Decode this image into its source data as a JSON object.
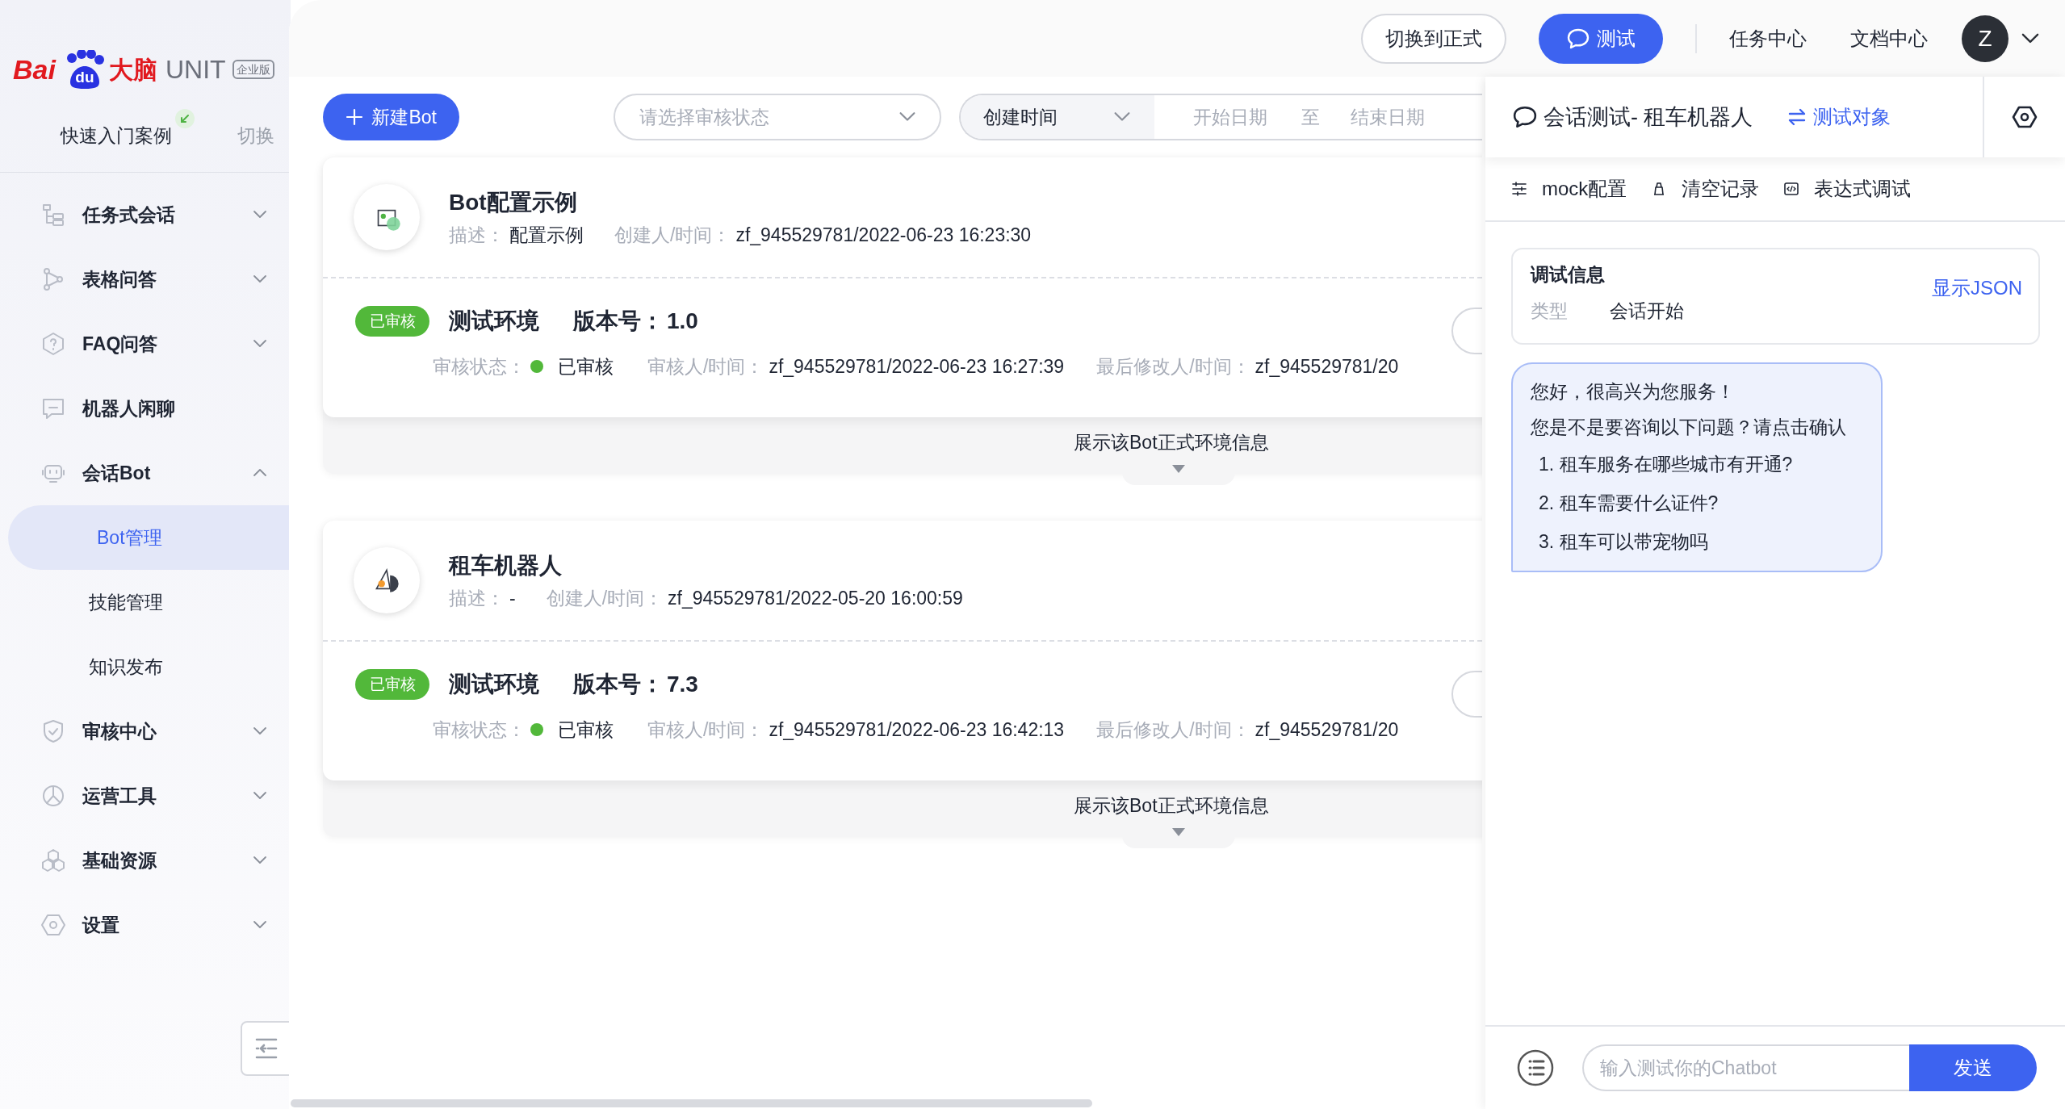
{
  "logo": {
    "brand": "Bai",
    "paw_text": "du",
    "brand_cn": "大脑",
    "product": "UNIT",
    "edition": "企业版"
  },
  "sidebar": {
    "quick_start": "快速入门案例",
    "switch": "切换",
    "items": [
      {
        "label": "任务式会话",
        "kind": "group",
        "expanded": false
      },
      {
        "label": "表格问答",
        "kind": "group",
        "expanded": false
      },
      {
        "label": "FAQ问答",
        "kind": "group",
        "expanded": false
      },
      {
        "label": "机器人闲聊",
        "kind": "link"
      },
      {
        "label": "会话Bot",
        "kind": "group",
        "expanded": true,
        "children": [
          {
            "label": "Bot管理",
            "selected": true
          },
          {
            "label": "技能管理",
            "selected": false
          },
          {
            "label": "知识发布",
            "selected": false
          }
        ]
      },
      {
        "label": "审核中心",
        "kind": "group",
        "expanded": false
      },
      {
        "label": "运营工具",
        "kind": "group",
        "expanded": false
      },
      {
        "label": "基础资源",
        "kind": "group",
        "expanded": false
      },
      {
        "label": "设置",
        "kind": "group",
        "expanded": false
      }
    ]
  },
  "topbar": {
    "switch_button": "切换到正式",
    "test_button": "测试",
    "links": [
      "任务中心",
      "文档中心"
    ],
    "avatar": "Z"
  },
  "toolbar": {
    "new_button": "新建Bot",
    "status_select": {
      "placeholder": "请选择审核状态"
    },
    "date_type": "创建时间",
    "start": {
      "placeholder": "开始日期"
    },
    "separator": "至",
    "end": {
      "placeholder": "结束日期"
    }
  },
  "bots": [
    {
      "name": "Bot配置示例",
      "desc_label": "描述：",
      "desc": "配置示例",
      "creator_label": "创建人/时间：",
      "creator": "zf_945529781/2022-06-23 16:23:30",
      "badge": "已审核",
      "env": "测试环境",
      "version_label": "版本号：",
      "version": "1.0",
      "review_label": "审核状态：",
      "review_state": "已审核",
      "color": "#52b83a",
      "reviewer_label": "审核人/时间：",
      "reviewer": "zf_945529781/2022-06-23 16:27:39",
      "modifier_label": "最后修改人/时间：",
      "modifier": "zf_945529781/20",
      "expand": "展示该Bot正式环境信息"
    },
    {
      "name": "租车机器人",
      "desc_label": "描述：",
      "desc": "-",
      "creator_label": "创建人/时间：",
      "creator": "zf_945529781/2022-05-20 16:00:59",
      "badge": "已审核",
      "env": "测试环境",
      "version_label": "版本号：",
      "version": "7.3",
      "review_label": "审核状态：",
      "review_state": "已审核",
      "color": "#52b83a",
      "reviewer_label": "审核人/时间：",
      "reviewer": "zf_945529781/2022-06-23 16:42:13",
      "modifier_label": "最后修改人/时间：",
      "modifier": "zf_945529781/20",
      "expand": "展示该Bot正式环境信息"
    }
  ],
  "panel": {
    "title": "会话测试- 租车机器人",
    "target": "测试对象",
    "tools": [
      "mock配置",
      "清空记录",
      "表达式调试"
    ],
    "debug": {
      "title": "调试信息",
      "type_label": "类型",
      "type_value": "会话开始",
      "json_link": "显示JSON"
    },
    "message": {
      "lines": [
        "您好，很高兴为您服务！",
        "您是不是要咨询以下问题？请点击确认"
      ],
      "options": [
        "1. 租车服务在哪些城市有开通?",
        "2. 租车需要什么证件?",
        "3. 租车可以带宠物吗"
      ]
    },
    "input": {
      "placeholder": "输入测试你的Chatbot"
    },
    "send": "发送"
  }
}
